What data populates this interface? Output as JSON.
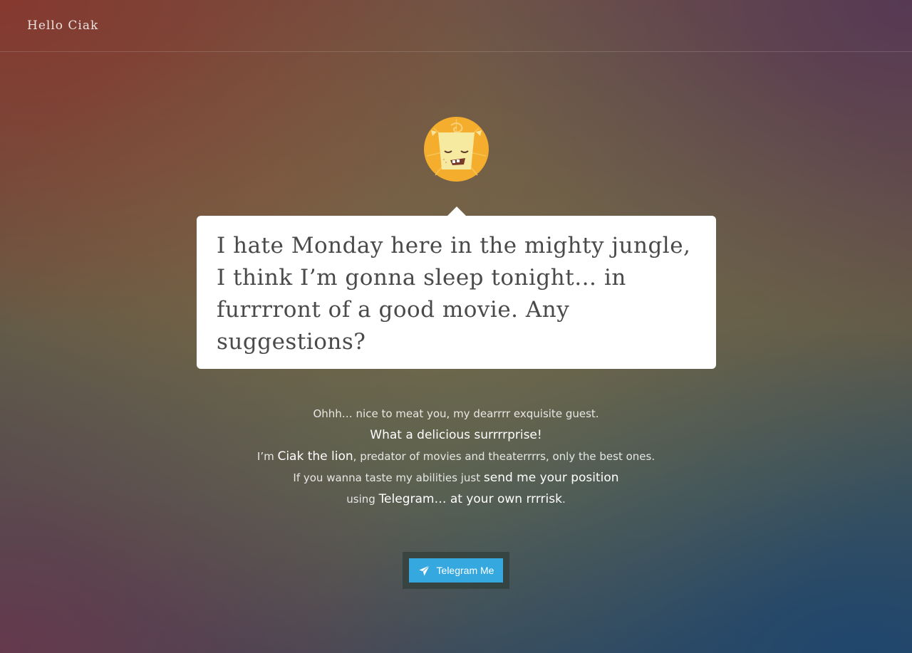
{
  "header": {
    "brand": "Hello Ciak"
  },
  "avatar": {
    "icon": "lion-icon"
  },
  "bubble": {
    "text": "I hate Monday here in the mighty jungle, I think I’m gonna sleep tonight… in furrrront of a good movie. Any suggestions?"
  },
  "intro": {
    "line1": "Ohhh… nice to meat you, my dearrrr exquisite guest.",
    "line2": "What a delicious surrrrprise!",
    "line3_prefix": "I’m ",
    "line3_highlight": "Ciak the lion",
    "line3_suffix": ", predator of movies and theaterrrrs, only the best ones.",
    "line4_prefix": "If you wanna taste my abilities just ",
    "line4_highlight": "send me your position",
    "line5_prefix": "using ",
    "line5_highlight": "Telegram… at your own rrrrisk",
    "line5_suffix": "."
  },
  "cta": {
    "label": "Telegram Me",
    "icon": "paper-plane-icon"
  },
  "colors": {
    "button": "#35a8e0",
    "avatar": "#f4ad2c",
    "bubble": "#ffffff"
  }
}
